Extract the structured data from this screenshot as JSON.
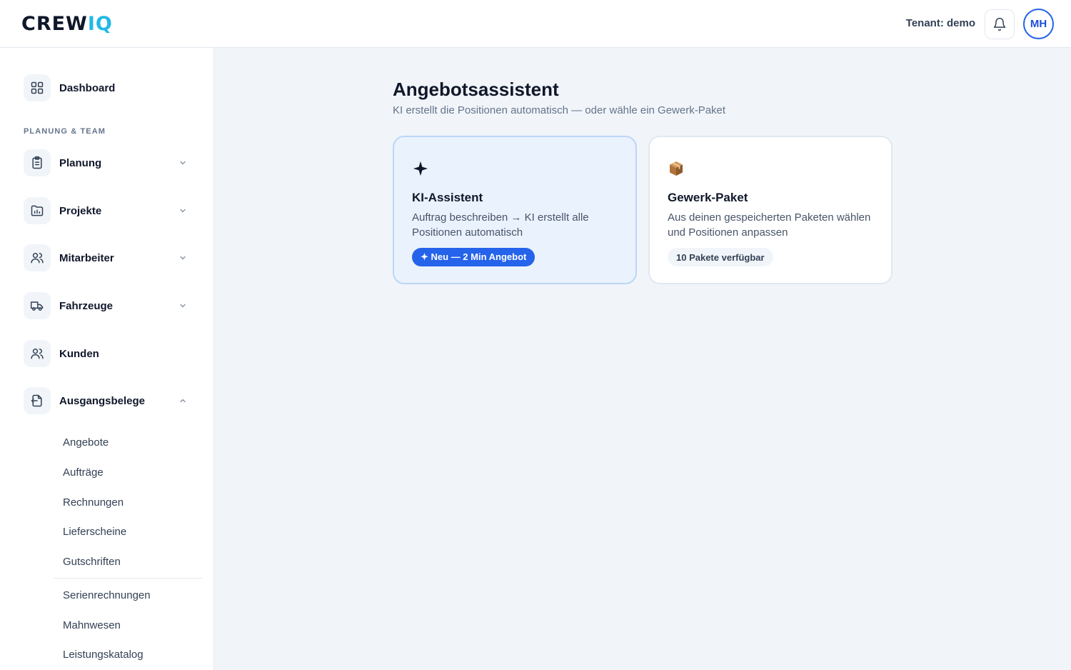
{
  "header": {
    "logo_main": "CREW",
    "logo_accent": "IQ",
    "tenant_text": "Tenant: demo",
    "avatar_initials": "MH"
  },
  "sidebar": {
    "dashboard_label": "Dashboard",
    "section_title": "PLANUNG & TEAM",
    "items": [
      {
        "label": "Planung",
        "icon": "clipboard-icon",
        "expanded": false
      },
      {
        "label": "Projekte",
        "icon": "folder-chart-icon",
        "expanded": false
      },
      {
        "label": "Mitarbeiter",
        "icon": "users-icon",
        "expanded": false
      },
      {
        "label": "Fahrzeuge",
        "icon": "truck-icon",
        "expanded": false
      },
      {
        "label": "Kunden",
        "icon": "customers-icon"
      },
      {
        "label": "Ausgangsbelege",
        "icon": "document-out-icon",
        "expanded": true
      }
    ],
    "subitems": [
      "Angebote",
      "Aufträge",
      "Rechnungen",
      "Lieferscheine",
      "Gutschriften",
      "Serienrechnungen",
      "Mahnwesen",
      "Leistungskatalog"
    ]
  },
  "main": {
    "title": "Angebotsassistent",
    "subtitle": "KI erstellt die Positionen automatisch — oder wähle ein Gewerk-Paket",
    "cards": [
      {
        "icon": "sparkle-icon",
        "icon_glyph": "✦",
        "title": "KI-Assistent",
        "description": "Auftrag beschreiben → KI erstellt alle Positionen automatisch",
        "badge": "✦ Neu — 2 Min Angebot"
      },
      {
        "icon": "package-icon",
        "title": "Gewerk-Paket",
        "description": "Aus deinen gespeicherten Paketen wählen und Positionen anpassen",
        "badge": "10 Pakete verfügbar"
      }
    ]
  },
  "colors": {
    "accent": "#2563eb",
    "logo_accent": "#22b8e6",
    "ki_card_bg": "#eaf2fd",
    "ki_card_border": "#bcd6f7"
  }
}
